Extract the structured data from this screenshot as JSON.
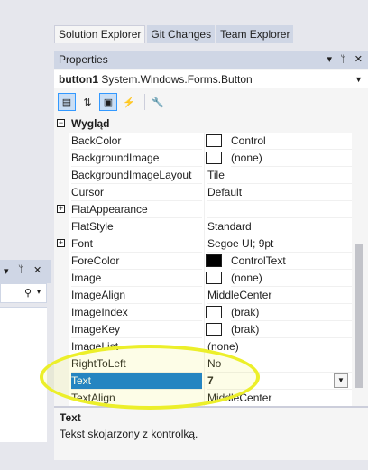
{
  "left": {
    "pin_icon": "pin-icon",
    "close_icon": "close-icon",
    "search_icon": "search-icon"
  },
  "tabs": [
    "Solution Explorer",
    "Git Changes",
    "Team Explorer"
  ],
  "properties": {
    "title": "Properties",
    "object_name": "button1",
    "object_type": "System.Windows.Forms.Button",
    "category": "Wygląd",
    "rows": [
      {
        "name": "BackColor",
        "value": "Control",
        "swatch": "#ffffff"
      },
      {
        "name": "BackgroundImage",
        "value": "(none)",
        "swatch": "#ffffff"
      },
      {
        "name": "BackgroundImageLayout",
        "value": "Tile"
      },
      {
        "name": "Cursor",
        "value": "Default"
      },
      {
        "name": "FlatAppearance",
        "value": "",
        "expand": true
      },
      {
        "name": "FlatStyle",
        "value": "Standard"
      },
      {
        "name": "Font",
        "value": "Segoe UI; 9pt",
        "expand": true
      },
      {
        "name": "ForeColor",
        "value": "ControlText",
        "swatch": "#000000"
      },
      {
        "name": "Image",
        "value": "(none)",
        "swatch": "#ffffff"
      },
      {
        "name": "ImageAlign",
        "value": "MiddleCenter"
      },
      {
        "name": "ImageIndex",
        "value": "(brak)",
        "swatch": "#ffffff"
      },
      {
        "name": "ImageKey",
        "value": "(brak)",
        "swatch": "#ffffff"
      },
      {
        "name": "ImageList",
        "value": "(none)"
      },
      {
        "name": "RightToLeft",
        "value": "No"
      },
      {
        "name": "Text",
        "value": "7",
        "selected": true
      },
      {
        "name": "TextAlign",
        "value": "MiddleCenter"
      }
    ],
    "description_title": "Text",
    "description_text": "Tekst skojarzony z kontrolką."
  },
  "colors": {
    "accent": "#0a77d4",
    "highlight": "#ecef2a"
  }
}
